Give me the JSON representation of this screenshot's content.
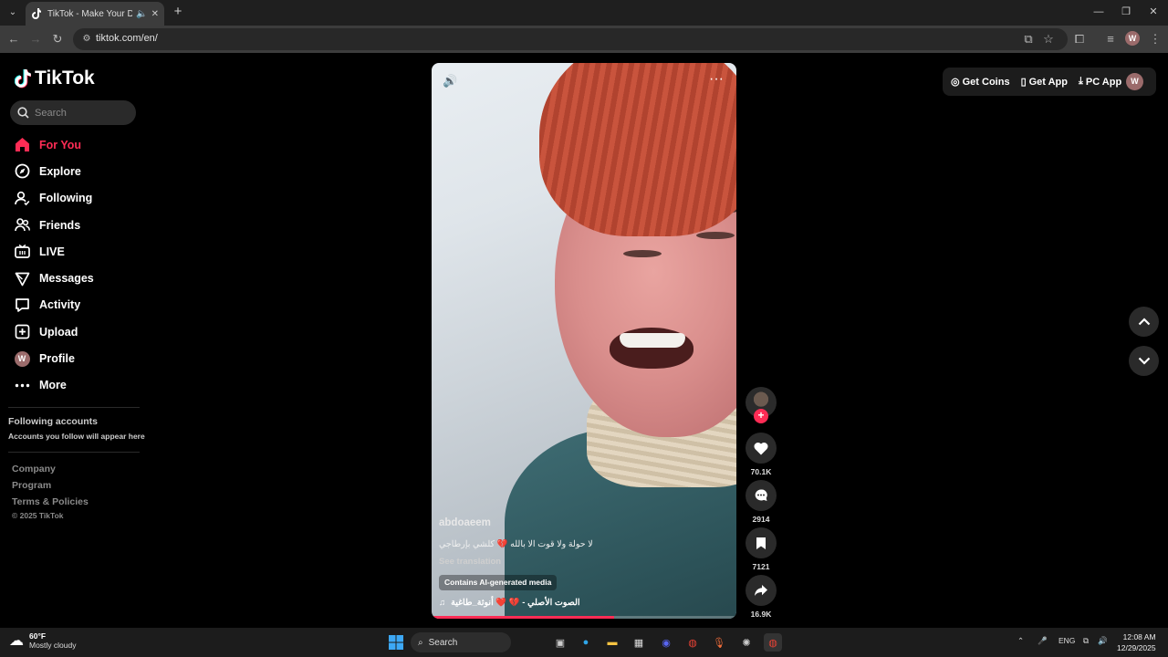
{
  "browser": {
    "tab_title": "TikTok - Make Your Day",
    "url": "tiktok.com/en/",
    "profile_initial": "W"
  },
  "sidebar": {
    "logo_text": "TikTok",
    "search_placeholder": "Search",
    "nav": [
      {
        "label": "For You",
        "icon": "home-icon",
        "active": true
      },
      {
        "label": "Explore",
        "icon": "compass-icon"
      },
      {
        "label": "Following",
        "icon": "user-follow-icon"
      },
      {
        "label": "Friends",
        "icon": "friends-icon"
      },
      {
        "label": "LIVE",
        "icon": "live-icon"
      },
      {
        "label": "Messages",
        "icon": "messages-icon"
      },
      {
        "label": "Activity",
        "icon": "activity-icon"
      },
      {
        "label": "Upload",
        "icon": "upload-icon"
      },
      {
        "label": "Profile",
        "icon": "profile-avatar",
        "initial": "W"
      },
      {
        "label": "More",
        "icon": "more-icon"
      }
    ],
    "following_title": "Following accounts",
    "following_sub": "Accounts you follow will appear here",
    "footer_links": [
      "Company",
      "Program",
      "Terms & Policies"
    ],
    "copyright": "© 2025 TikTok"
  },
  "video": {
    "username": "abdoaeem",
    "caption": "لا حولة ولا قوت الا بالله 💔 كلشي بإرطاجي",
    "see_translation": "See translation",
    "ai_badge": "Contains AI-generated media",
    "music": "الصوت الأصلي - 💔 ❤️ أنوثة_طاغية",
    "progress": 0.6
  },
  "actions": {
    "likes": "70.1K",
    "comments": "2914",
    "saves": "7121",
    "shares": "16.9K"
  },
  "header_right": {
    "get_coins": "Get Coins",
    "get_app": "Get App",
    "pc_app": "PC App",
    "avatar_initial": "W"
  },
  "taskbar": {
    "temp": "60°F",
    "condition": "Mostly cloudy",
    "search_label": "Search",
    "lang": "ENG",
    "time": "12:08 AM",
    "date": "12/29/2025"
  }
}
